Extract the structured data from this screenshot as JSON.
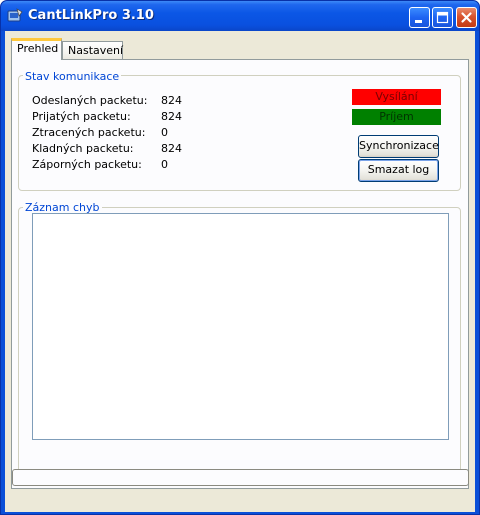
{
  "window": {
    "title": "CantLinkPro 3.10",
    "icon": "app-icon",
    "controls": [
      "minimize-icon",
      "maximize-icon",
      "close-icon"
    ]
  },
  "tabs": [
    {
      "label": "Prehled",
      "active": true
    },
    {
      "label": "Nastavení",
      "active": false
    }
  ],
  "stav": {
    "title": "Stav komunikace",
    "stats": [
      {
        "label": "Odeslaných packetu:",
        "value": "824"
      },
      {
        "label": "Prijatých packetu:",
        "value": "824"
      },
      {
        "label": "Ztracených packetu:",
        "value": "0"
      },
      {
        "label": "Kladných packetu:",
        "value": "824"
      },
      {
        "label": "Záporných packetu:",
        "value": "0"
      }
    ],
    "indicators": {
      "tx": {
        "label": "Vysílání",
        "color": "#ff0000"
      },
      "rx": {
        "label": "Príjem",
        "color": "#008000"
      }
    },
    "buttons": {
      "sync": "Synchronizace",
      "clear": "Smazat log"
    }
  },
  "log": {
    "title": "Záznam chyb",
    "entries": []
  },
  "colors": {
    "accent": "#0046d5",
    "titlebar": "#0a50df",
    "tab_highlight": "#ffc83c"
  }
}
